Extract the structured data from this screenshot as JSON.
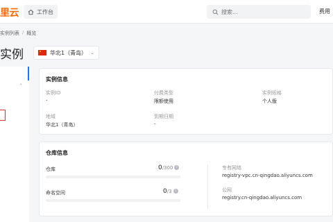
{
  "topbar": {
    "logo": "里云",
    "workbench_label": "工作台",
    "search_placeholder": "搜索...",
    "right_text": "费用"
  },
  "breadcrumb": {
    "items": [
      "实例列表",
      "/",
      "概览"
    ]
  },
  "page": {
    "title": "实例",
    "region": "华北1（青岛）"
  },
  "instance_info": {
    "title": "实例信息",
    "fields": [
      {
        "label": "实例ID",
        "value": "-"
      },
      {
        "label": "付费类型",
        "value": "限额使用"
      },
      {
        "label": "实例规格",
        "value": "个人版"
      },
      {
        "label": "地域",
        "value": "华北1（青岛）"
      },
      {
        "label": "到期日期",
        "value": "-"
      }
    ]
  },
  "repo_info": {
    "title": "仓库信息",
    "repos": {
      "label": "仓库",
      "used": "0",
      "total": "/300",
      "usage_fraction": 0
    },
    "namespaces": {
      "label": "命名空间",
      "used": "0",
      "total": "/3",
      "usage_fraction": 0
    },
    "vpc": {
      "label": "专有网络",
      "value": "registry-vpc.cn-qingdao.aliyuncs.com"
    },
    "public": {
      "label": "公网",
      "value": "registry.cn-qingdao.aliyuncs.com"
    }
  },
  "colors": {
    "brand": "#ff6a00",
    "accent": "#1a70ff",
    "alert": "#e3342f"
  },
  "icons": {
    "workbench": "home-icon",
    "search": "search-icon",
    "info": "info-icon",
    "region_flag": "china-flag-icon"
  }
}
